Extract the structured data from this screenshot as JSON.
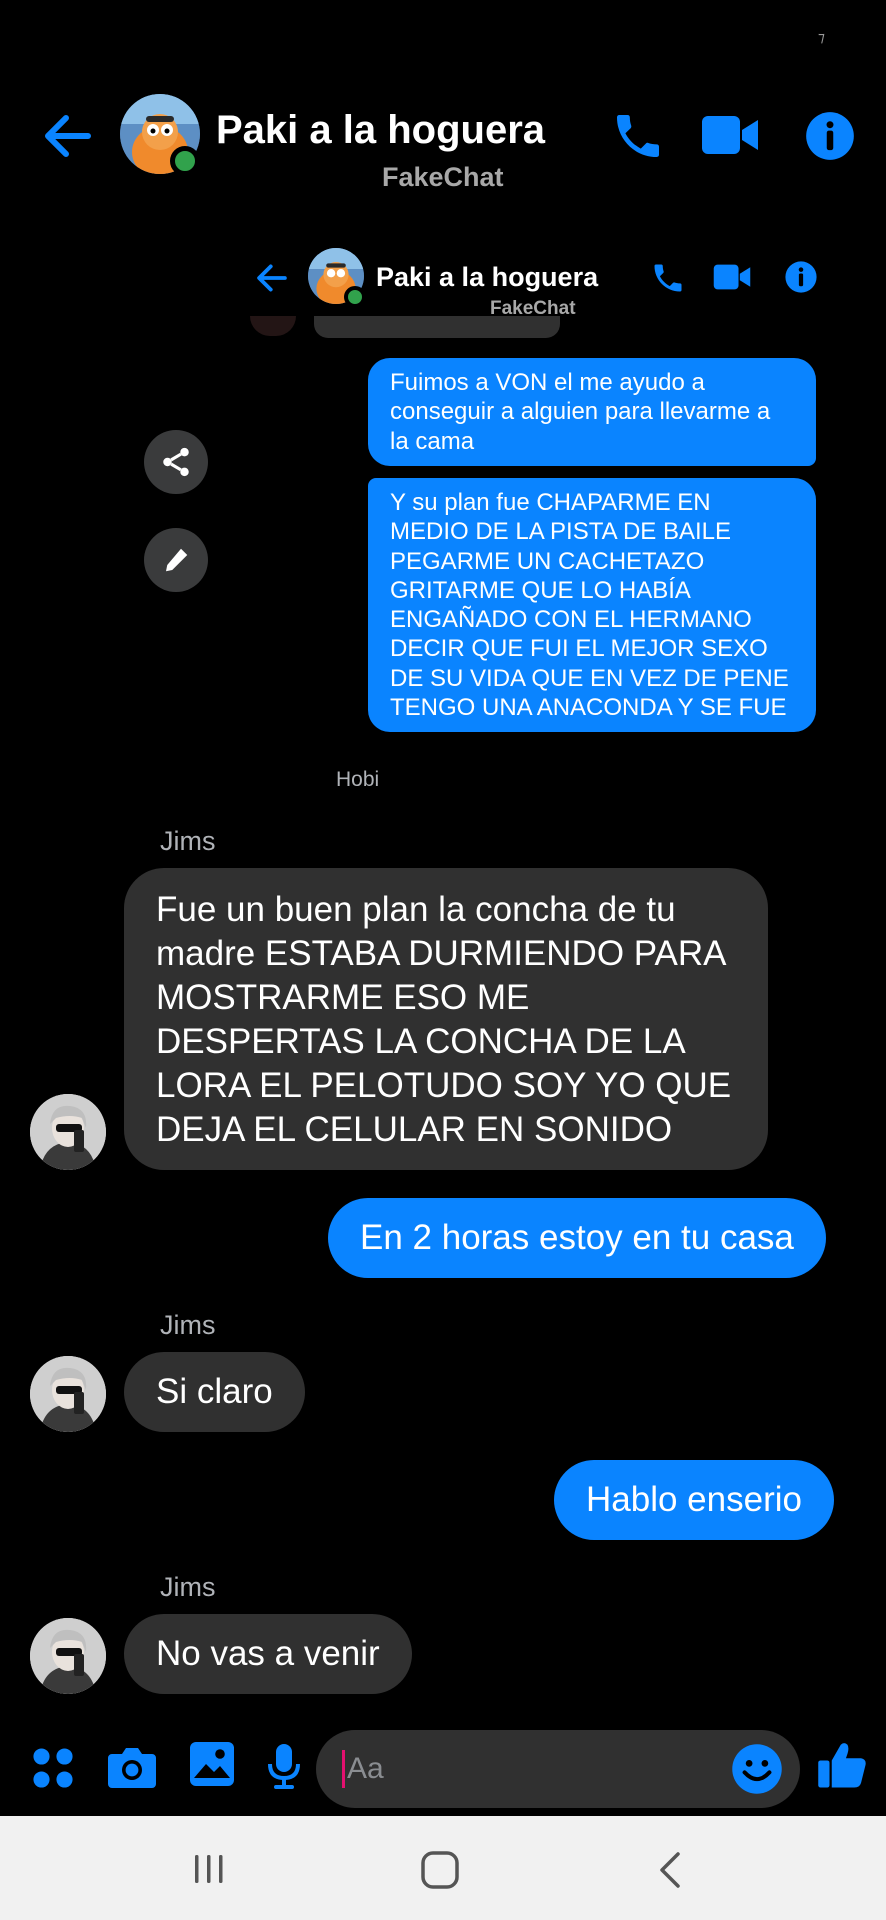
{
  "status": {
    "mark": "⁊"
  },
  "header": {
    "title": "Paki a la hoguera",
    "subtitle": "FakeChat"
  },
  "embedded_header": {
    "title": "Paki a la hoguera",
    "subtitle": "FakeChat"
  },
  "messages_embedded": [
    {
      "direction": "out",
      "text": "Fuimos a VON el me ayudo a conseguir a alguien para llevarme a la cama"
    },
    {
      "direction": "out",
      "text": "Y su plan fue CHAPARME EN MEDIO DE LA PISTA DE BAILE PEGARME UN CACHETAZO GRITARME QUE LO HABÍA ENGAÑADO CON EL HERMANO DECIR QUE FUI EL MEJOR SEXO DE SU VIDA QUE EN VEZ DE PENE TENGO UNA ANACONDA Y SE FUE"
    }
  ],
  "embedded_caption": "Hobi",
  "messages": [
    {
      "direction": "in",
      "sender": "Jims",
      "text": "Fue un buen plan la concha de tu madre ESTABA DURMIENDO PARA MOSTRARME ESO ME DESPERTAS LA CONCHA DE LA LORA  EL PELOTUDO SOY YO QUE DEJA EL CELULAR EN SONIDO"
    },
    {
      "direction": "out",
      "text": "En 2 horas estoy en tu casa"
    },
    {
      "direction": "in",
      "sender": "Jims",
      "text": "Si claro"
    },
    {
      "direction": "out",
      "text": "Hablo enserio"
    },
    {
      "direction": "in",
      "sender": "Jims",
      "text": "No vas a venir"
    }
  ],
  "composer": {
    "placeholder": "Aa"
  },
  "colors": {
    "accent": "#0a84ff",
    "incoming_bubble": "#303030",
    "background": "#000000",
    "online": "#31a24c"
  },
  "icons": [
    "back-arrow-icon",
    "phone-icon",
    "video-camera-icon",
    "info-icon",
    "share-icon",
    "pencil-icon",
    "apps-icon",
    "camera-icon",
    "gallery-icon",
    "microphone-icon",
    "emoji-icon",
    "thumbs-up-icon",
    "recent-apps-icon",
    "home-icon",
    "nav-back-icon"
  ]
}
